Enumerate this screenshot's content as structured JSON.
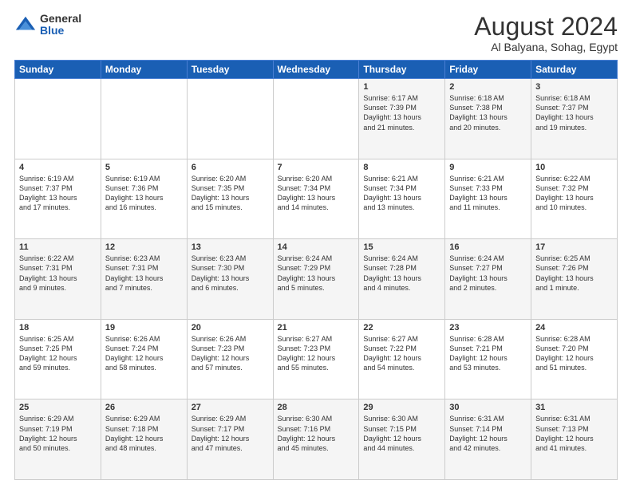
{
  "logo": {
    "general": "General",
    "blue": "Blue"
  },
  "header": {
    "month": "August 2024",
    "location": "Al Balyana, Sohag, Egypt"
  },
  "weekdays": [
    "Sunday",
    "Monday",
    "Tuesday",
    "Wednesday",
    "Thursday",
    "Friday",
    "Saturday"
  ],
  "weeks": [
    [
      {
        "day": "",
        "info": ""
      },
      {
        "day": "",
        "info": ""
      },
      {
        "day": "",
        "info": ""
      },
      {
        "day": "",
        "info": ""
      },
      {
        "day": "1",
        "info": "Sunrise: 6:17 AM\nSunset: 7:39 PM\nDaylight: 13 hours\nand 21 minutes."
      },
      {
        "day": "2",
        "info": "Sunrise: 6:18 AM\nSunset: 7:38 PM\nDaylight: 13 hours\nand 20 minutes."
      },
      {
        "day": "3",
        "info": "Sunrise: 6:18 AM\nSunset: 7:37 PM\nDaylight: 13 hours\nand 19 minutes."
      }
    ],
    [
      {
        "day": "4",
        "info": "Sunrise: 6:19 AM\nSunset: 7:37 PM\nDaylight: 13 hours\nand 17 minutes."
      },
      {
        "day": "5",
        "info": "Sunrise: 6:19 AM\nSunset: 7:36 PM\nDaylight: 13 hours\nand 16 minutes."
      },
      {
        "day": "6",
        "info": "Sunrise: 6:20 AM\nSunset: 7:35 PM\nDaylight: 13 hours\nand 15 minutes."
      },
      {
        "day": "7",
        "info": "Sunrise: 6:20 AM\nSunset: 7:34 PM\nDaylight: 13 hours\nand 14 minutes."
      },
      {
        "day": "8",
        "info": "Sunrise: 6:21 AM\nSunset: 7:34 PM\nDaylight: 13 hours\nand 13 minutes."
      },
      {
        "day": "9",
        "info": "Sunrise: 6:21 AM\nSunset: 7:33 PM\nDaylight: 13 hours\nand 11 minutes."
      },
      {
        "day": "10",
        "info": "Sunrise: 6:22 AM\nSunset: 7:32 PM\nDaylight: 13 hours\nand 10 minutes."
      }
    ],
    [
      {
        "day": "11",
        "info": "Sunrise: 6:22 AM\nSunset: 7:31 PM\nDaylight: 13 hours\nand 9 minutes."
      },
      {
        "day": "12",
        "info": "Sunrise: 6:23 AM\nSunset: 7:31 PM\nDaylight: 13 hours\nand 7 minutes."
      },
      {
        "day": "13",
        "info": "Sunrise: 6:23 AM\nSunset: 7:30 PM\nDaylight: 13 hours\nand 6 minutes."
      },
      {
        "day": "14",
        "info": "Sunrise: 6:24 AM\nSunset: 7:29 PM\nDaylight: 13 hours\nand 5 minutes."
      },
      {
        "day": "15",
        "info": "Sunrise: 6:24 AM\nSunset: 7:28 PM\nDaylight: 13 hours\nand 4 minutes."
      },
      {
        "day": "16",
        "info": "Sunrise: 6:24 AM\nSunset: 7:27 PM\nDaylight: 13 hours\nand 2 minutes."
      },
      {
        "day": "17",
        "info": "Sunrise: 6:25 AM\nSunset: 7:26 PM\nDaylight: 13 hours\nand 1 minute."
      }
    ],
    [
      {
        "day": "18",
        "info": "Sunrise: 6:25 AM\nSunset: 7:25 PM\nDaylight: 12 hours\nand 59 minutes."
      },
      {
        "day": "19",
        "info": "Sunrise: 6:26 AM\nSunset: 7:24 PM\nDaylight: 12 hours\nand 58 minutes."
      },
      {
        "day": "20",
        "info": "Sunrise: 6:26 AM\nSunset: 7:23 PM\nDaylight: 12 hours\nand 57 minutes."
      },
      {
        "day": "21",
        "info": "Sunrise: 6:27 AM\nSunset: 7:23 PM\nDaylight: 12 hours\nand 55 minutes."
      },
      {
        "day": "22",
        "info": "Sunrise: 6:27 AM\nSunset: 7:22 PM\nDaylight: 12 hours\nand 54 minutes."
      },
      {
        "day": "23",
        "info": "Sunrise: 6:28 AM\nSunset: 7:21 PM\nDaylight: 12 hours\nand 53 minutes."
      },
      {
        "day": "24",
        "info": "Sunrise: 6:28 AM\nSunset: 7:20 PM\nDaylight: 12 hours\nand 51 minutes."
      }
    ],
    [
      {
        "day": "25",
        "info": "Sunrise: 6:29 AM\nSunset: 7:19 PM\nDaylight: 12 hours\nand 50 minutes."
      },
      {
        "day": "26",
        "info": "Sunrise: 6:29 AM\nSunset: 7:18 PM\nDaylight: 12 hours\nand 48 minutes."
      },
      {
        "day": "27",
        "info": "Sunrise: 6:29 AM\nSunset: 7:17 PM\nDaylight: 12 hours\nand 47 minutes."
      },
      {
        "day": "28",
        "info": "Sunrise: 6:30 AM\nSunset: 7:16 PM\nDaylight: 12 hours\nand 45 minutes."
      },
      {
        "day": "29",
        "info": "Sunrise: 6:30 AM\nSunset: 7:15 PM\nDaylight: 12 hours\nand 44 minutes."
      },
      {
        "day": "30",
        "info": "Sunrise: 6:31 AM\nSunset: 7:14 PM\nDaylight: 12 hours\nand 42 minutes."
      },
      {
        "day": "31",
        "info": "Sunrise: 6:31 AM\nSunset: 7:13 PM\nDaylight: 12 hours\nand 41 minutes."
      }
    ]
  ]
}
